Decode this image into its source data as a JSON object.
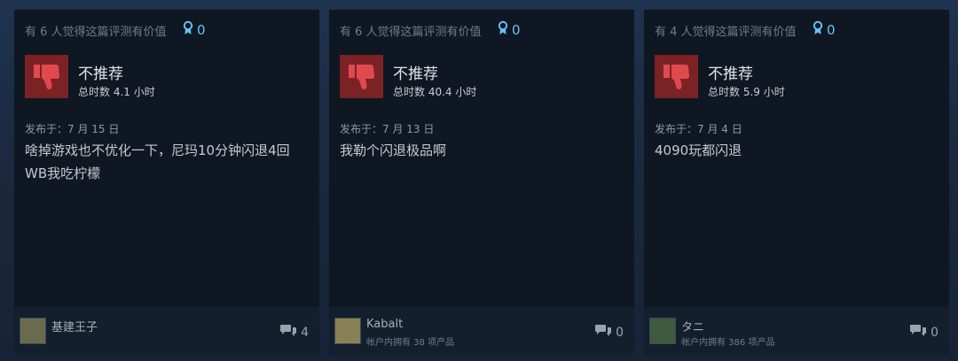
{
  "reviews": [
    {
      "helpful": "有 6 人觉得这篇评测有价值",
      "awards": "0",
      "recommendation": "不推荐",
      "hours": "总时数 4.1 小时",
      "posted": "发布于：7 月 15 日",
      "text": "啥掉游戏也不优化一下，尼玛10分钟闪退4回WB我吃柠檬",
      "author": "基建王子",
      "products": "",
      "comments": "4"
    },
    {
      "helpful": "有 6 人觉得这篇评测有价值",
      "awards": "0",
      "recommendation": "不推荐",
      "hours": "总时数 40.4 小时",
      "posted": "发布于：7 月 13 日",
      "text": "我勒个闪退极品啊",
      "author": "Kabalt",
      "products": "帐户内拥有 38 项产品",
      "comments": "0"
    },
    {
      "helpful": "有 4 人觉得这篇评测有价值",
      "awards": "0",
      "recommendation": "不推荐",
      "hours": "总时数 5.9 小时",
      "posted": "发布于：7 月 4 日",
      "text": "4090玩都闪退",
      "author": "タニ",
      "products": "帐户内拥有 386 项产品",
      "comments": "0"
    }
  ],
  "icons": {
    "award": "award-ribbon-icon",
    "thumb": "thumbs-down-icon",
    "comment": "comment-bubble-icon"
  },
  "colors": {
    "not_recommended_bg": "#7b2225",
    "thumb": "#e04a4f",
    "award": "#67c1f5",
    "card_bg": "#0f1722"
  }
}
